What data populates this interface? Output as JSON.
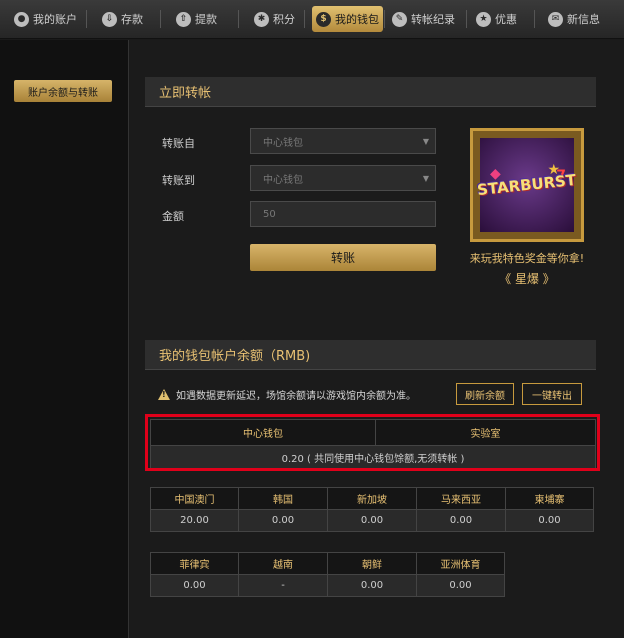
{
  "nav": {
    "items": [
      {
        "label": "我的账户",
        "icon": "user-icon"
      },
      {
        "label": "存款",
        "icon": "deposit-icon"
      },
      {
        "label": "提款",
        "icon": "withdraw-icon"
      },
      {
        "label": "积分",
        "icon": "points-icon"
      },
      {
        "label": "我的钱包",
        "icon": "dollar-icon",
        "active": true
      },
      {
        "label": "转帐纪录",
        "icon": "pencil-icon"
      },
      {
        "label": "优惠",
        "icon": "star-icon"
      },
      {
        "label": "新信息",
        "icon": "mail-icon"
      }
    ]
  },
  "sidebar": {
    "button_label": "账户余额与转账"
  },
  "transfer": {
    "title": "立即转帐",
    "from_label": "转账自",
    "from_value": "中心钱包",
    "to_label": "转账到",
    "to_value": "中心钱包",
    "amount_label": "金额",
    "amount_placeholder": "50",
    "submit_label": "转账"
  },
  "promo": {
    "logo_text": "STARBURST",
    "line1": "来玩我特色奖金等你拿!",
    "line2": "《 星爆 》"
  },
  "balance": {
    "title": "我的钱包帐户余额（RMB)",
    "warning": "如遇数据更新延迟，场馆余额请以游戏馆内余额为准。",
    "refresh_label": "刷新余额",
    "transfer_all_label": "一键转出",
    "main_table": {
      "headers": [
        "中心钱包",
        "实验室"
      ],
      "value": "0.20 ( 共同使用中心钱包馀额,无须转帐 )"
    },
    "region_table1": {
      "headers": [
        "中国澳门",
        "韩国",
        "新加坡",
        "马来西亚",
        "柬埔寨"
      ],
      "values": [
        "20.00",
        "0.00",
        "0.00",
        "0.00",
        "0.00"
      ]
    },
    "region_table2": {
      "headers": [
        "菲律宾",
        "越南",
        "朝鲜",
        "亚洲体育"
      ],
      "values": [
        "0.00",
        "-",
        "0.00",
        "0.00"
      ]
    }
  },
  "colors": {
    "accent": "#e8c173",
    "highlight": "#e0001a"
  }
}
